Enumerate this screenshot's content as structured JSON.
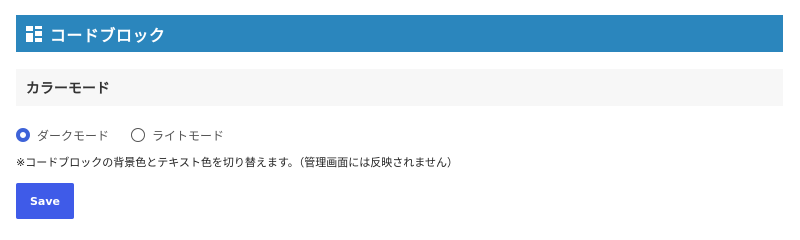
{
  "header": {
    "icon": "block-grid-icon",
    "title": "コードブロック"
  },
  "section": {
    "title": "カラーモード"
  },
  "color_mode": {
    "options": [
      {
        "label": "ダークモード",
        "selected": true
      },
      {
        "label": "ライトモード",
        "selected": false
      }
    ]
  },
  "note": "※コードブロックの背景色とテキスト色を切り替えます。（管理画面には反映されません）",
  "actions": {
    "save_label": "Save"
  },
  "colors": {
    "header_bg": "#2b86bd",
    "section_bg": "#f7f7f7",
    "accent": "#3e63d8",
    "button_bg": "#3f5be8"
  }
}
